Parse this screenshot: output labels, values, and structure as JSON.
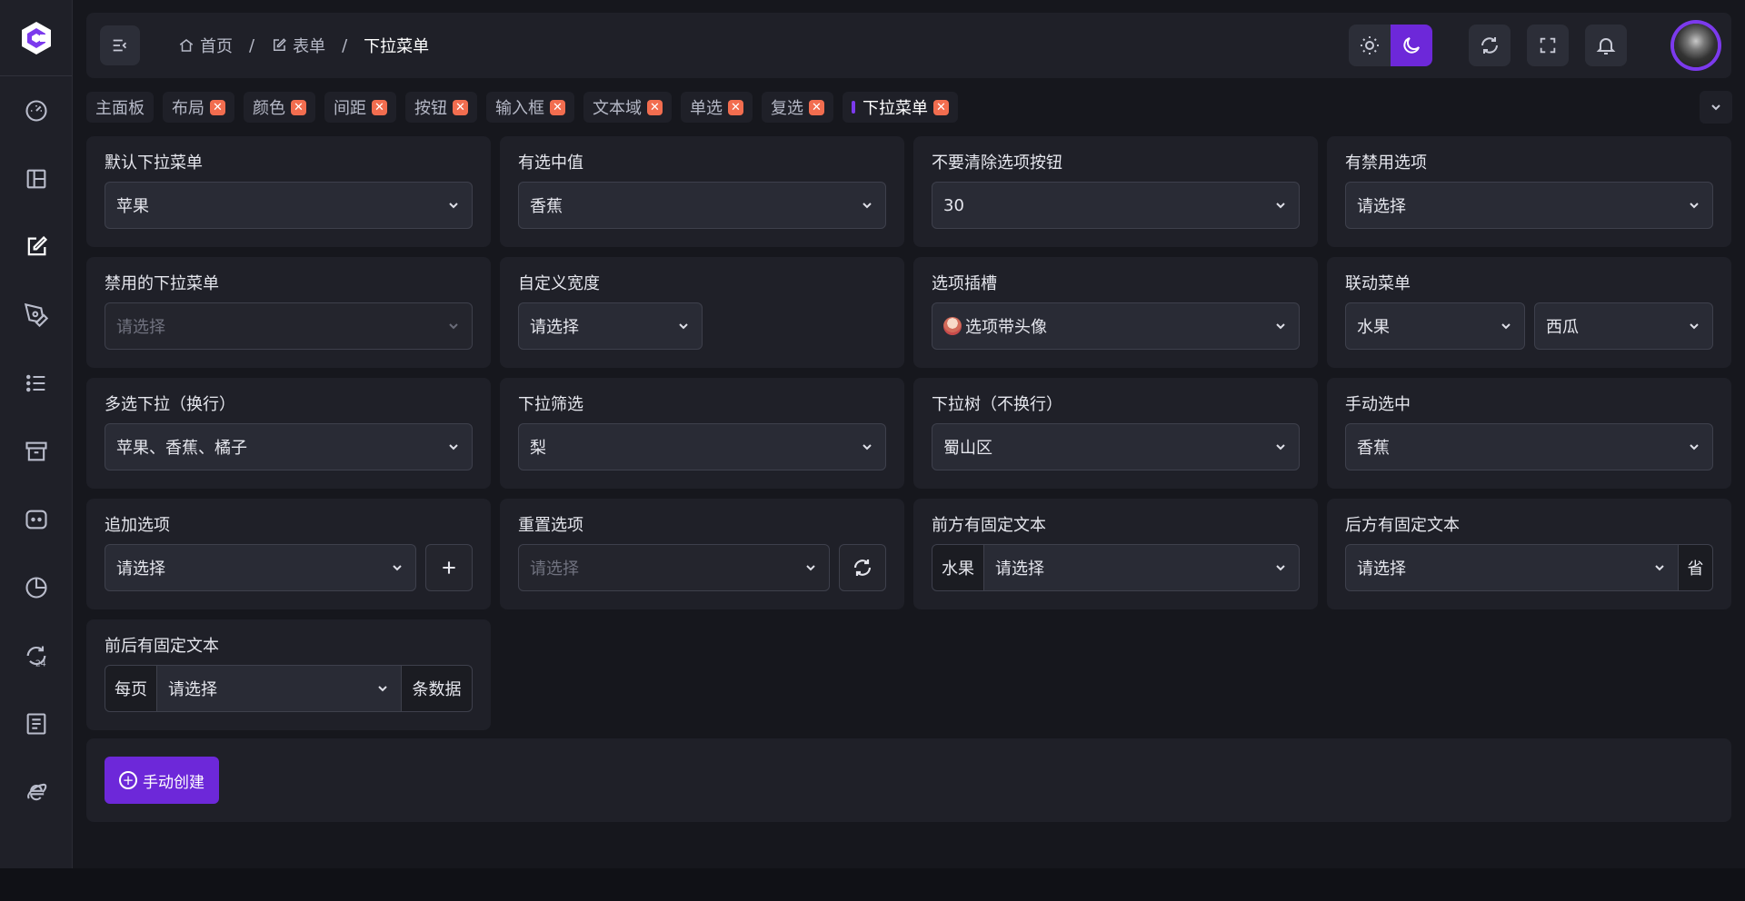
{
  "breadcrumb": [
    {
      "label": "首页",
      "icon": "home-icon"
    },
    {
      "label": "表单",
      "icon": "edit-icon"
    },
    {
      "label": "下拉菜单"
    }
  ],
  "breadcrumb_sep": "/",
  "tabs": [
    {
      "label": "主面板",
      "closable": false
    },
    {
      "label": "布局",
      "closable": true
    },
    {
      "label": "颜色",
      "closable": true
    },
    {
      "label": "间距",
      "closable": true
    },
    {
      "label": "按钮",
      "closable": true
    },
    {
      "label": "输入框",
      "closable": true
    },
    {
      "label": "文本域",
      "closable": true
    },
    {
      "label": "单选",
      "closable": true
    },
    {
      "label": "复选",
      "closable": true
    },
    {
      "label": "下拉菜单",
      "closable": true,
      "active": true
    }
  ],
  "tab_close_glyph": "✕",
  "cards": {
    "c1": {
      "title": "默认下拉菜单",
      "value": "苹果"
    },
    "c2": {
      "title": "有选中值",
      "value": "香蕉"
    },
    "c3": {
      "title": "不要清除选项按钮",
      "value": "30"
    },
    "c4": {
      "title": "有禁用选项",
      "value": "请选择"
    },
    "c5": {
      "title": "禁用的下拉菜单",
      "value": "请选择"
    },
    "c6": {
      "title": "自定义宽度",
      "value": "请选择"
    },
    "c7": {
      "title": "选项插槽",
      "value": "选项带头像"
    },
    "c8": {
      "title": "联动菜单",
      "value1": "水果",
      "value2": "西瓜"
    },
    "c9": {
      "title": "多选下拉（换行）",
      "value": "苹果、香蕉、橘子"
    },
    "c10": {
      "title": "下拉筛选",
      "value": "梨"
    },
    "c11": {
      "title": "下拉树（不换行）",
      "value": "蜀山区"
    },
    "c12": {
      "title": "手动选中",
      "value": "香蕉"
    },
    "c13": {
      "title": "追加选项",
      "value": "请选择"
    },
    "c14": {
      "title": "重置选项",
      "value": "请选择"
    },
    "c15": {
      "title": "前方有固定文本",
      "prefix": "水果",
      "value": "请选择"
    },
    "c16": {
      "title": "后方有固定文本",
      "value": "请选择",
      "suffix": "省"
    },
    "c17": {
      "title": "前后有固定文本",
      "prefix": "每页",
      "value": "请选择",
      "suffix": "条数据"
    }
  },
  "create_button": "手动创建",
  "colors": {
    "accent": "#6d28d9",
    "tab_close": "#f26d4f",
    "background": "#16171d",
    "panel": "#1f2028"
  }
}
